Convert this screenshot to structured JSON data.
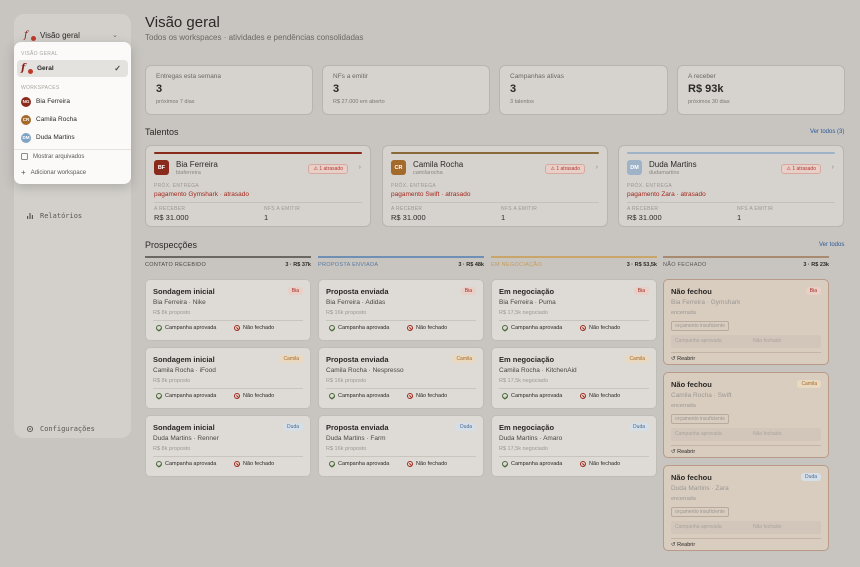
{
  "sidebar": {
    "workspace_label": "Visão geral",
    "nav_reports": "Relatórios",
    "nav_settings": "Configurações"
  },
  "dropdown": {
    "section_general": "VISÃO GERAL",
    "general_item": "Geral",
    "section_workspaces": "WORKSPACES",
    "workspaces": [
      {
        "initials": "NG",
        "name": "Bia Ferreira",
        "color": "#8a2a1c"
      },
      {
        "initials": "CR",
        "name": "Camila Rocha",
        "color": "#a36a2c"
      },
      {
        "initials": "DM",
        "name": "Duda Martins",
        "color": "#7fa3c4"
      }
    ],
    "show_archived": "Mostrar arquivados",
    "add_workspace": "Adicionar workspace"
  },
  "page": {
    "title": "Visão geral",
    "subtitle": "Todos os workspaces · atividades e pendências consolidadas"
  },
  "stats": [
    {
      "label": "Entregas esta semana",
      "value": "3",
      "sub": "próximos 7 dias"
    },
    {
      "label": "NFs a emitir",
      "value": "3",
      "sub": "R$ 27.000 em aberto"
    },
    {
      "label": "Campanhas ativas",
      "value": "3",
      "sub": "3 talentos"
    },
    {
      "label": "A receber",
      "value": "R$ 93k",
      "sub": "próximos 30 dias"
    }
  ],
  "talents_section": {
    "title": "Talentos",
    "link": "Ver todos (3)"
  },
  "talents": [
    {
      "initials": "BF",
      "name": "Bia Ferreira",
      "handle": "biaferreira",
      "badge": "1 atrasado",
      "next_label": "PRÓX. ENTREGA",
      "next_value": "pagamento Gymshark · atrasado",
      "recv_label": "A RECEBER",
      "recv_value": "R$ 31.000",
      "nf_label": "NFS A EMITIR",
      "nf_value": "1",
      "color": "#8a2a1c",
      "bar": "#8a2a1c"
    },
    {
      "initials": "CR",
      "name": "Camila Rocha",
      "handle": "camilarocha",
      "badge": "1 atrasado",
      "next_label": "PRÓX. ENTREGA",
      "next_value": "pagamento Swift · atrasado",
      "recv_label": "A RECEBER",
      "recv_value": "R$ 31.000",
      "nf_label": "NFS A EMITIR",
      "nf_value": "1",
      "color": "#a36a2c",
      "bar": "#8a6a3a"
    },
    {
      "initials": "DM",
      "name": "Duda Martins",
      "handle": "dudamartins",
      "badge": "1 atrasado",
      "next_label": "PRÓX. ENTREGA",
      "next_value": "pagamento Zara · atrasado",
      "recv_label": "A RECEBER",
      "recv_value": "R$ 31.000",
      "nf_label": "NFS A EMITIR",
      "nf_value": "1",
      "color": "#9fb3c8",
      "bar": "#9fb3c8"
    }
  ],
  "prospect_section": {
    "title": "Prospecções",
    "link": "Ver todos"
  },
  "columns": [
    {
      "label": "CONTATO RECEBIDO",
      "count": "3 · R$ 37k",
      "line": "#6b6864",
      "label_color": "#4a4744"
    },
    {
      "label": "PROPOSTA ENVIADA",
      "count": "3 · R$ 48k",
      "line": "#6f8fb5",
      "label_color": "#5a7aa0"
    },
    {
      "label": "EM NEGOCIAÇÃO",
      "count": "3 · R$ 53,5k",
      "line": "#c9a56a",
      "label_color": "#c39a5a"
    },
    {
      "label": "NÃO FECHADO",
      "count": "3 · R$ 23k",
      "line": "#a88a70",
      "label_color": "#5a5753"
    }
  ],
  "prospects": [
    [
      {
        "title": "Sondagem inicial",
        "person": "Bia Ferreira · Nike",
        "value": "R$ 8k proposto",
        "tag": "Bia",
        "tag_bg": "#e8cfc8",
        "tag_fg": "#a2281d"
      },
      {
        "title": "Sondagem inicial",
        "person": "Camila Rocha · iFood",
        "value": "R$ 8k proposto",
        "tag": "Camila",
        "tag_bg": "#ead9c1",
        "tag_fg": "#a36a2c"
      },
      {
        "title": "Sondagem inicial",
        "person": "Duda Martins · Renner",
        "value": "R$ 8k proposto",
        "tag": "Duda",
        "tag_bg": "#d6dfe8",
        "tag_fg": "#4a6a90"
      }
    ],
    [
      {
        "title": "Proposta enviada",
        "person": "Bia Ferreira · Adidas",
        "value": "R$ 16k proposto",
        "tag": "Bia",
        "tag_bg": "#e8cfc8",
        "tag_fg": "#a2281d"
      },
      {
        "title": "Proposta enviada",
        "person": "Camila Rocha · Nespresso",
        "value": "R$ 16k proposto",
        "tag": "Camila",
        "tag_bg": "#ead9c1",
        "tag_fg": "#a36a2c"
      },
      {
        "title": "Proposta enviada",
        "person": "Duda Martins · Farm",
        "value": "R$ 16k proposto",
        "tag": "Duda",
        "tag_bg": "#d6dfe8",
        "tag_fg": "#4a6a90"
      }
    ],
    [
      {
        "title": "Em negociação",
        "person": "Bia Ferreira · Puma",
        "value": "R$ 17,5k negociado",
        "tag": "Bia",
        "tag_bg": "#e8cfc8",
        "tag_fg": "#a2281d"
      },
      {
        "title": "Em negociação",
        "person": "Camila Rocha · KitchenAid",
        "value": "R$ 17,5k negociado",
        "tag": "Camila",
        "tag_bg": "#ead9c1",
        "tag_fg": "#a36a2c"
      },
      {
        "title": "Em negociação",
        "person": "Duda Martins · Amaro",
        "value": "R$ 17,5k negociado",
        "tag": "Duda",
        "tag_bg": "#d6dfe8",
        "tag_fg": "#4a6a90"
      }
    ]
  ],
  "prospect_actions": {
    "approve": "Campanha aprovada",
    "reject": "Não fechado"
  },
  "lost": [
    {
      "title": "Não fechou",
      "person": "Bia Ferreira · Gymshark",
      "status": "encerrada",
      "tag": "Bia",
      "tag_bg": "#e8cfc8",
      "tag_fg": "#a2281d",
      "reason": "orçamento insuficiente",
      "reopen": "Reabrir"
    },
    {
      "title": "Não fechou",
      "person": "Camila Rocha · Swift",
      "status": "encerrada",
      "tag": "Camila",
      "tag_bg": "#ead9c1",
      "tag_fg": "#a36a2c",
      "reason": "orçamento insuficiente",
      "reopen": "Reabrir"
    },
    {
      "title": "Não fechou",
      "person": "Duda Martins · Zara",
      "status": "encerrada",
      "tag": "Duda",
      "tag_bg": "#d6dfe8",
      "tag_fg": "#4a6a90",
      "reason": "orçamento insuficiente",
      "reopen": "Reabrir"
    }
  ]
}
